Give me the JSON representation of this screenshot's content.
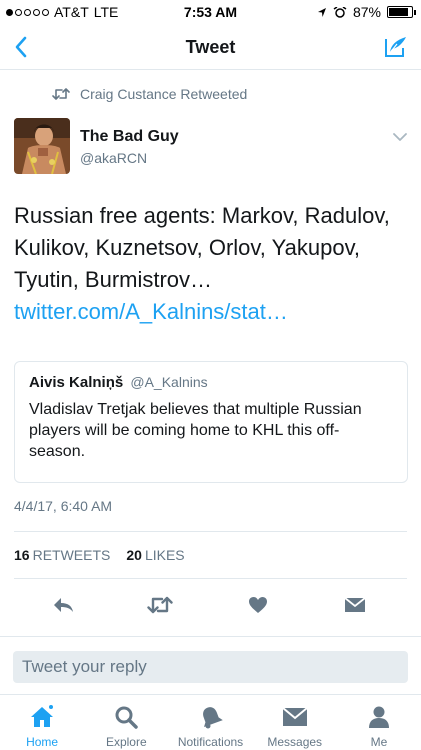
{
  "status_bar": {
    "carrier": "AT&T",
    "network": "LTE",
    "time": "7:53 AM",
    "battery": "87%",
    "battery_level": 0.87
  },
  "nav": {
    "title": "Tweet"
  },
  "retweet_context": "Craig Custance Retweeted",
  "author": {
    "name": "The Bad Guy",
    "handle": "@akaRCN"
  },
  "tweet": {
    "text": "Russian free agents: Markov, Radulov, Kulikov, Kuznetsov, Orlov, Yakupov, Tyutin, Burmistrov… ",
    "link": "twitter.com/A_Kalnins/stat…"
  },
  "quoted": {
    "name": "Aivis Kalniņš",
    "handle": "@A_Kalnins",
    "text": "Vladislav Tretjak believes that multiple Russian players will be coming home to KHL this off-season."
  },
  "timestamp": "4/4/17, 6:40 AM",
  "stats": {
    "retweets_count": "16",
    "retweets_label": "RETWEETS",
    "likes_count": "20",
    "likes_label": "LIKES"
  },
  "reply_placeholder": "Tweet your reply",
  "tabs": [
    {
      "label": "Home",
      "icon": "home-icon"
    },
    {
      "label": "Explore",
      "icon": "search-icon"
    },
    {
      "label": "Notifications",
      "icon": "bell-icon"
    },
    {
      "label": "Messages",
      "icon": "envelope-icon"
    },
    {
      "label": "Me",
      "icon": "person-icon"
    }
  ],
  "colors": {
    "accent": "#1da1f2",
    "secondary_text": "#657786",
    "icon_gray": "#657786"
  }
}
